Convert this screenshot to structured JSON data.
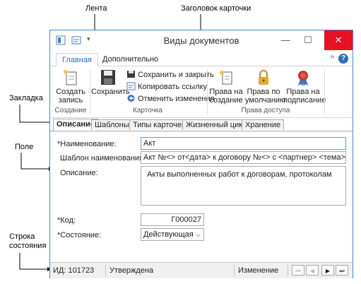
{
  "callouts": {
    "ribbon": "Лента",
    "card_title": "Заголовок карточки",
    "bookmark": "Закладка",
    "field": "Поле",
    "status_bar": "Строка\nсостояния"
  },
  "window": {
    "title": "Виды документов",
    "minimize": "—",
    "maximize": "☐",
    "close": "✕"
  },
  "tabs": {
    "main": "Главная",
    "extra": "Дополнительно",
    "collapse": "^",
    "help": "?"
  },
  "ribbon": {
    "create": "Создать\nзапись",
    "save": "Сохранить",
    "save_close": "Сохранить и закрыть",
    "copy_link": "Копировать ссылку",
    "cancel_changes": "Отменить изменения",
    "rights_create": "Права на\nсоздание",
    "rights_default": "Права по\nумолчанию",
    "rights_sign": "Права на\nподписание",
    "group_create": "Создание",
    "group_card": "Карточка",
    "group_access": "Права доступа"
  },
  "form_tabs": [
    "Описание",
    "Шаблоны",
    "Типы карточек",
    "Жизненный цикл",
    "Хранение"
  ],
  "form": {
    "name_label": "*Наименование:",
    "name_value": "Акт",
    "template_label": "Шаблон наименования:",
    "template_value": "Акт №<> от<дата> к договору №<> с <партнер> <тема>",
    "desc_label": "Описание:",
    "desc_value": "Акты выполненных работ к договорам, протоколам",
    "code_label": "*Код:",
    "code_value": "Г000027",
    "state_label": "*Состояние:",
    "state_value": "Действующая"
  },
  "status": {
    "id": "ИД: 101723",
    "state": "Утверждена",
    "mode": "Изменение",
    "nav_first": "⏮",
    "nav_prev": "◀",
    "nav_next": "▶",
    "nav_last": "⏭"
  },
  "colors": {
    "accent": "#2a6ebb",
    "close": "#e81123",
    "border": "#3c8fce"
  }
}
